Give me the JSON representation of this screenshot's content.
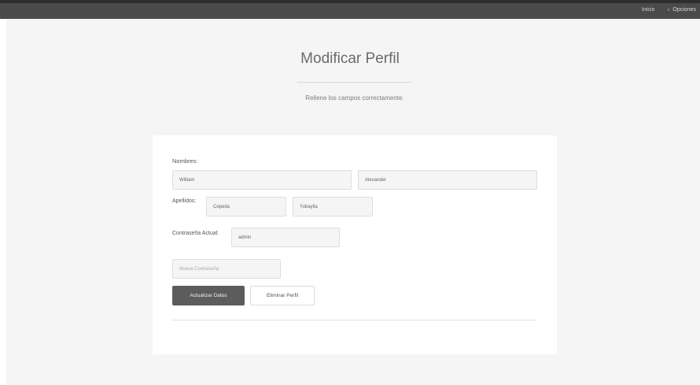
{
  "nav": {
    "inicio": "Inicio",
    "opciones": "Opciones"
  },
  "header": {
    "title": "Modificar Perfil",
    "subtitle": "Rellene los campos correctamente."
  },
  "form": {
    "nombres_label": "Nombres:",
    "first_name": "William",
    "second_name": "Alexander",
    "apellidos_label": "Apellidos:",
    "first_surname": "Cepeda",
    "second_surname": "Yubaylla",
    "password_label": "Contraseña Actual:",
    "current_password": "admin",
    "new_password_placeholder": "Nueva Contraseña",
    "update_button": "Actualizar Datos",
    "delete_button": "Eliminar Perfil"
  }
}
